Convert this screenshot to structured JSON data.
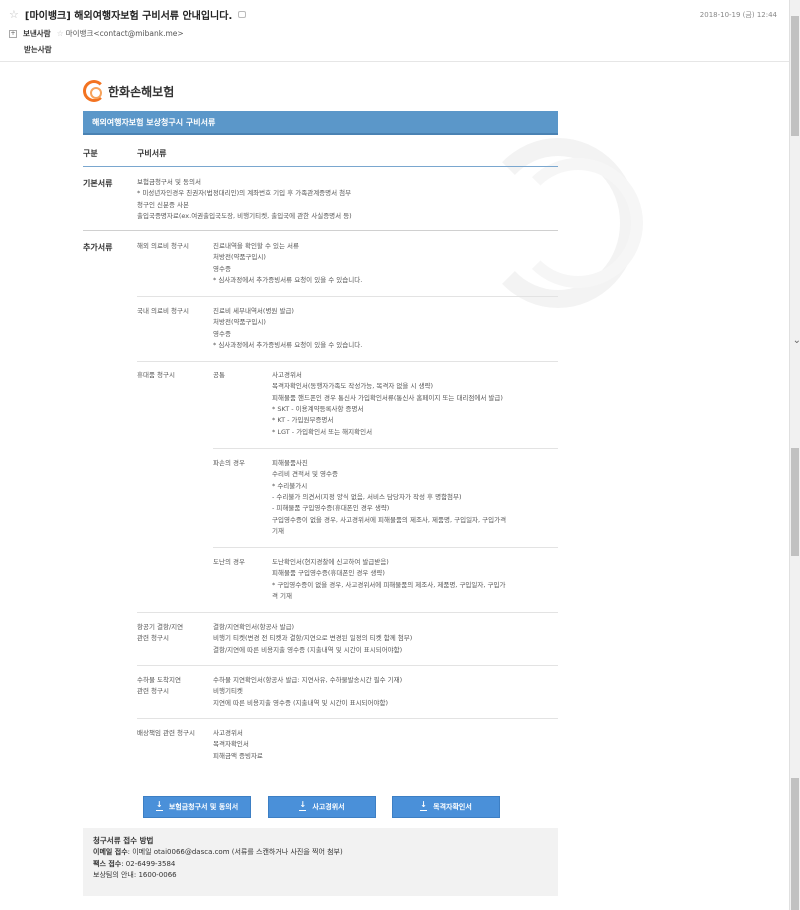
{
  "email": {
    "subject": "[마이뱅크] 해외여행자보험 구비서류 안내입니다.",
    "date": "2018-10-19 (금) 12:44",
    "from_label": "보낸사람",
    "from_name": "마이뱅크<contact@mibank.me>",
    "to_label": "받는사람",
    "expand_symbol": "+",
    "star_glyph": "☆"
  },
  "brand": {
    "name": "한화손해보험",
    "accent": "#f37321"
  },
  "banner": {
    "title": "해외여행자보험 보상청구시 구비서류",
    "color": "#5b97c9"
  },
  "table": {
    "col_category": "구분",
    "col_docs": "구비서류",
    "basic": {
      "label": "기본서류",
      "lines": [
        "보험금청구서 및 동의서",
        "* 미성년자인경우 친권자(법정대리인)의 계좌번호 기입 후 가족관계증명서 첨부",
        "청구인 신분증 사본",
        "출입국증명자료(ex.여권출입국도장, 비행기티켓, 출입국에 관한 사실증명서 등)"
      ]
    },
    "additional": {
      "label": "추가서류",
      "overseas": {
        "label": "해외 의료비 청구시",
        "lines": [
          "진료내역을 확인할 수 있는 서류",
          "처방전(약품구입시)",
          "영수증",
          "* 심사과정에서 추가증빙서류 요청이 있을 수 있습니다."
        ]
      },
      "domestic": {
        "label": "국내 의료비 청구시",
        "lines": [
          "진료비 세부내역서(병원 발급)",
          "처방전(약품구입시)",
          "영수증",
          "* 심사과정에서 추가증빙서류 요청이 있을 수 있습니다."
        ]
      },
      "belongings": {
        "label": "휴대품 청구시",
        "common": {
          "label": "공통",
          "lines": [
            "사고경위서",
            "목격자확인서(동행자가족도 작성가능, 목격자 없을 시 생략)",
            "피해물품 핸드폰인 경우 통신사 가입확인서류(통신사 홈페이지 또는 대리점에서 발급)",
            "* SKT - 이용계약등록사항 증명서",
            "* KT - 가입원부증명서",
            "* LGT - 가입확인서 또는 해지확인서"
          ]
        },
        "damage": {
          "label": "파손의 경우",
          "lines": [
            "피해물품사진",
            "수리비 견적서 및 영수증",
            "* 수리불가시",
            "- 수리불가 의견서(지정 양식 없음, 서비스 담당자가 작성 후 명함첨부)",
            "- 피해물품 구입영수증(휴대폰인 경우 생략)",
            "구입영수증이 없을 경우, 사고경위서에 피해물품의 제조사, 제품명, 구입일자, 구입가격",
            "기재"
          ]
        },
        "theft": {
          "label": "도난의 경우",
          "lines": [
            "도난확인서(현지경찰에 신고하여 발급받음)",
            "피해물품 구입영수증(휴대폰인 경우 생략)",
            "* 구입영수증이 없을 경우, 사고경위서에 피해물품의 제조사, 제품명, 구입일자, 구입가",
            "격 기재"
          ]
        }
      },
      "flight": {
        "label_lines": [
          "항공기 결항/지연",
          "관련 청구시"
        ],
        "lines": [
          "결항/지연확인서(항공사 발급)",
          "비행기 티켓(변경 전 티켓과 결항/지연으로 변경된 일정의 티켓 함께 첨부)",
          "결항/지연에 따른 비용지출 영수증 (지출내역 및 시간이 표시되어야함)"
        ]
      },
      "baggage": {
        "label_lines": [
          "수하물 도착지연",
          "관련 청구시"
        ],
        "lines": [
          "수하물 지연확인서(항공사 발급: 지연사유, 수하물발송시간 필수 기재)",
          "비행기티켓",
          "지연에 따른 비용지출 영수증 (지출내역 및 시간이 표시되어야함)"
        ]
      },
      "liability": {
        "label": "배상책임 관련 청구시",
        "lines": [
          "사고경위서",
          "목격자확인서",
          "피해금액 증빙자료"
        ]
      }
    }
  },
  "buttons": {
    "claim_form": "보험금청구서 및 동의서",
    "accident_report": "사고경위서",
    "witness": "목격자확인서"
  },
  "info": {
    "title": "청구서류 접수 방법",
    "email_label": "이메일 접수",
    "email_value": ": 이메일 otai0066@dasca.com (서류를 스캔하거나 사진을 찍어 첨부)",
    "fax_label": "팩스 접수",
    "fax_value": ": 02-6499-3584",
    "phone_label": "보상팀의 안내",
    "phone_value": ": 1600-0066"
  }
}
